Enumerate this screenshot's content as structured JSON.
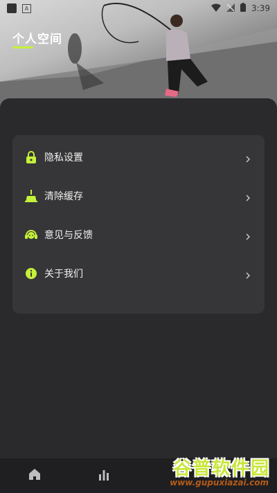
{
  "status_bar": {
    "time": "3:39"
  },
  "header": {
    "title": "个人空间"
  },
  "menu": {
    "items": [
      {
        "label": "隐私设置",
        "icon": "lock-icon"
      },
      {
        "label": "清除缓存",
        "icon": "broom-icon"
      },
      {
        "label": "意见与反馈",
        "icon": "headset-icon"
      },
      {
        "label": "关于我们",
        "icon": "info-icon"
      }
    ]
  },
  "bottom_nav": {
    "items": [
      {
        "icon": "home-icon"
      },
      {
        "icon": "stats-icon"
      },
      {
        "icon": "nav-icon-3"
      },
      {
        "icon": "nav-icon-4"
      }
    ]
  },
  "watermark": {
    "title": "谷普软件园",
    "url": "www.gupuxiazai.com"
  },
  "colors": {
    "accent": "#c5f13a",
    "background": "#2a2a2c",
    "card": "#363638",
    "nav": "#1f1f21"
  }
}
